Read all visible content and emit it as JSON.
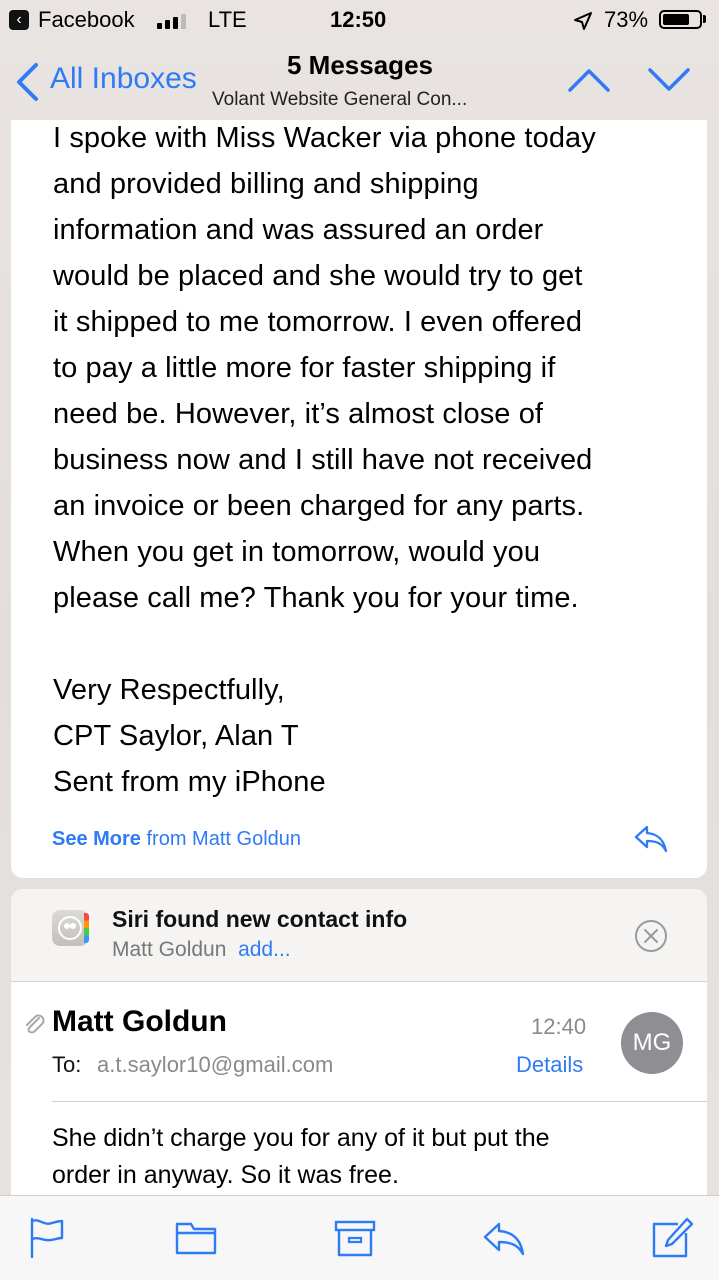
{
  "status_bar": {
    "back_app": "Facebook",
    "network": "LTE",
    "time": "12:50",
    "battery_percent": "73%",
    "battery_level": 0.73,
    "signal_bars": 3
  },
  "nav": {
    "back_label": "All Inboxes",
    "title": "5 Messages",
    "subtitle": "Volant Website General Con..."
  },
  "message1": {
    "body_lines": [
      "I spoke with Miss Wacker via phone today",
      "and provided billing and shipping",
      "information and was assured an order",
      "would be placed and she would try to get",
      "it shipped to me tomorrow. I even offered",
      "to pay a little more for faster shipping if",
      "need be.  However, it’s almost close of",
      "business now and I still have not received",
      "an invoice or been charged for any parts.",
      "When you get in tomorrow, would you",
      "please call me? Thank you for your time."
    ],
    "signature_lines": [
      "Very Respectfully,",
      "CPT Saylor, Alan T",
      "Sent from my iPhone"
    ],
    "see_more": "See More",
    "see_more_from": "from Matt Goldun"
  },
  "siri_banner": {
    "title": "Siri found new contact info",
    "name": "Matt Goldun",
    "add": "add..."
  },
  "message2": {
    "sender": "Matt Goldun",
    "to_label": "To:",
    "to_address": "a.t.saylor10@gmail.com",
    "time": "12:40",
    "details": "Details",
    "avatar_initials": "MG",
    "body_lines": [
      "She didn’t charge you for any of it but put the",
      "order in anyway.  So it was free."
    ]
  },
  "toolbar": {
    "icons": [
      "flag-icon",
      "folder-icon",
      "archive-icon",
      "reply-icon",
      "compose-icon"
    ]
  },
  "colors": {
    "accent": "#2f7bf6",
    "secondary_text": "#8a8a8a",
    "avatar": "#8e8e93"
  }
}
